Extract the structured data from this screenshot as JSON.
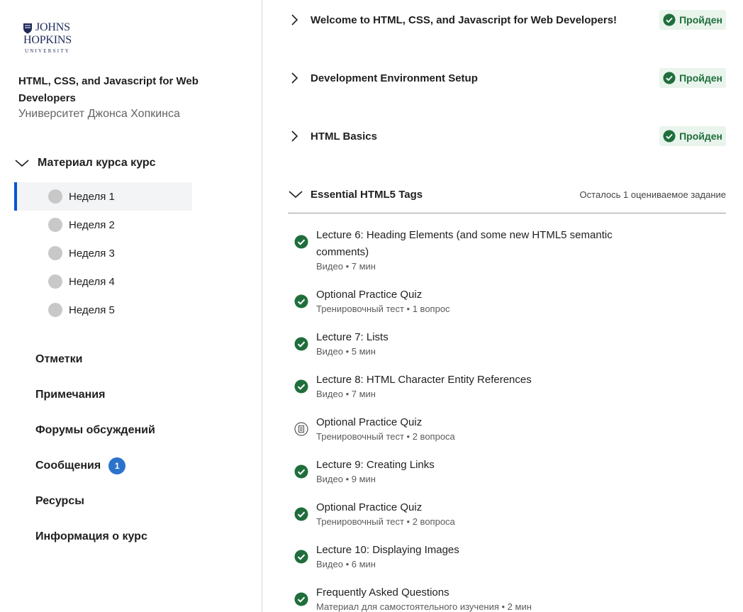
{
  "logo": {
    "line1": "JOHNS",
    "line2": "HOPKINS",
    "line3": "UNIVERSITY"
  },
  "course": {
    "title": "HTML, CSS, and Javascript for Web Developers",
    "organization": "Университет Джонса Хопкинса"
  },
  "sidebar": {
    "material_label": "Материал курса курс",
    "weeks": [
      {
        "label": "Неделя 1",
        "active": true
      },
      {
        "label": "Неделя 2",
        "active": false
      },
      {
        "label": "Неделя 3",
        "active": false
      },
      {
        "label": "Неделя 4",
        "active": false
      },
      {
        "label": "Неделя 5",
        "active": false
      }
    ],
    "nav": [
      {
        "label": "Отметки"
      },
      {
        "label": "Примечания"
      },
      {
        "label": "Форумы обсуждений"
      },
      {
        "label": "Сообщения",
        "badge": "1"
      },
      {
        "label": "Ресурсы"
      },
      {
        "label": "Информация о курс"
      }
    ]
  },
  "modules": [
    {
      "title": "Welcome to HTML, CSS, and Javascript for Web Developers!",
      "status": "Пройден",
      "expanded": false
    },
    {
      "title": "Development Environment Setup",
      "status": "Пройден",
      "expanded": false
    },
    {
      "title": "HTML Basics",
      "status": "Пройден",
      "expanded": false
    },
    {
      "title": "Essential HTML5 Tags",
      "status": "Осталось 1 оцениваемое задание",
      "expanded": true
    }
  ],
  "items": [
    {
      "title": "Lecture 6: Heading Elements (and some new HTML5 semantic comments)",
      "meta": "Видео • 7 мин",
      "state": "completed"
    },
    {
      "title": "Optional Practice Quiz",
      "meta": "Тренировочный тест • 1 вопрос",
      "state": "completed"
    },
    {
      "title": "Lecture 7: Lists",
      "meta": "Видео • 5 мин",
      "state": "completed"
    },
    {
      "title": "Lecture 8: HTML Character Entity References",
      "meta": "Видео • 7 мин",
      "state": "completed"
    },
    {
      "title": "Optional Practice Quiz",
      "meta": "Тренировочный тест • 2 вопроса",
      "state": "not-started"
    },
    {
      "title": "Lecture 9: Creating Links",
      "meta": "Видео • 9 мин",
      "state": "completed"
    },
    {
      "title": "Optional Practice Quiz",
      "meta": "Тренировочный тест • 2 вопроса",
      "state": "completed"
    },
    {
      "title": "Lecture 10: Displaying Images",
      "meta": "Видео • 6 мин",
      "state": "completed"
    },
    {
      "title": "Frequently Asked Questions",
      "meta": "Материал для самостоятельного изучения • 2 мин",
      "state": "completed"
    }
  ],
  "colors": {
    "accent": "#0056d2",
    "success": "#1f6e3c",
    "success_bg": "#e9f4ec",
    "badge": "#2a73cc"
  },
  "icons": {
    "completed": "check-circle-icon",
    "not-started": "quiz-outline-icon",
    "collapsed": "chevron-right-icon",
    "expanded": "chevron-down-icon"
  }
}
